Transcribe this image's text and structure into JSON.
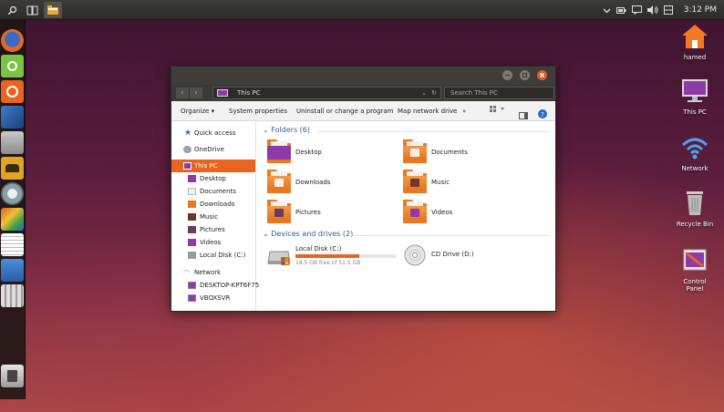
{
  "top_panel": {
    "clock": "3:12 PM"
  },
  "desktop": {
    "icons": [
      {
        "label": "hamed",
        "icon": "home-folder-icon"
      },
      {
        "label": "This PC",
        "icon": "monitor-icon"
      },
      {
        "label": "Network",
        "icon": "wifi-icon"
      },
      {
        "label": "Recycle Bin",
        "icon": "trash-icon"
      },
      {
        "label": "Control Panel",
        "icon": "control-panel-icon"
      }
    ]
  },
  "launcher": {
    "items": [
      "firefox-icon",
      "ubuntu-software-icon",
      "ubuntu-icon",
      "terminal-icon",
      "grey-app-icon",
      "contacts-icon",
      "disk-icon",
      "paint-icon",
      "notes-icon",
      "chart-icon",
      "calculator-icon",
      "trash-icon"
    ]
  },
  "window": {
    "address": "This PC",
    "search_placeholder": "Search This PC",
    "toolbar": {
      "organize": "Organize ▾",
      "system_properties": "System properties",
      "uninstall": "Uninstall or change a program",
      "map_drive": "Map network drive",
      "more": "»"
    },
    "nav": {
      "quick_access": "Quick access",
      "onedrive": "OneDrive",
      "this_pc": "This PC",
      "this_pc_children": [
        "Desktop",
        "Documents",
        "Downloads",
        "Music",
        "Pictures",
        "Videos",
        "Local Disk (C:)"
      ],
      "network": "Network",
      "network_children": [
        "DESKTOP-KPT6F75",
        "VBOXSVR"
      ]
    },
    "folders_header": "Folders (6)",
    "folders": [
      {
        "name": "Desktop",
        "color": "#8e3aa8"
      },
      {
        "name": "Documents",
        "color": "#f5f0ea"
      },
      {
        "name": "Downloads",
        "color": "#f5f0ea"
      },
      {
        "name": "Music",
        "color": "#6b3b2a"
      },
      {
        "name": "Pictures",
        "color": "#6b3b5a"
      },
      {
        "name": "Videos",
        "color": "#8e3aa8"
      }
    ],
    "devices_header": "Devices and drives (2)",
    "drives": {
      "local_name": "Local Disk (C:)",
      "local_free": "18.5 GB free of 51.5 GB",
      "local_used_fraction": 0.64,
      "cd_name": "CD Drive (D:)"
    }
  },
  "colors": {
    "accent": "#e9641f",
    "panel": "#3c3b37"
  }
}
